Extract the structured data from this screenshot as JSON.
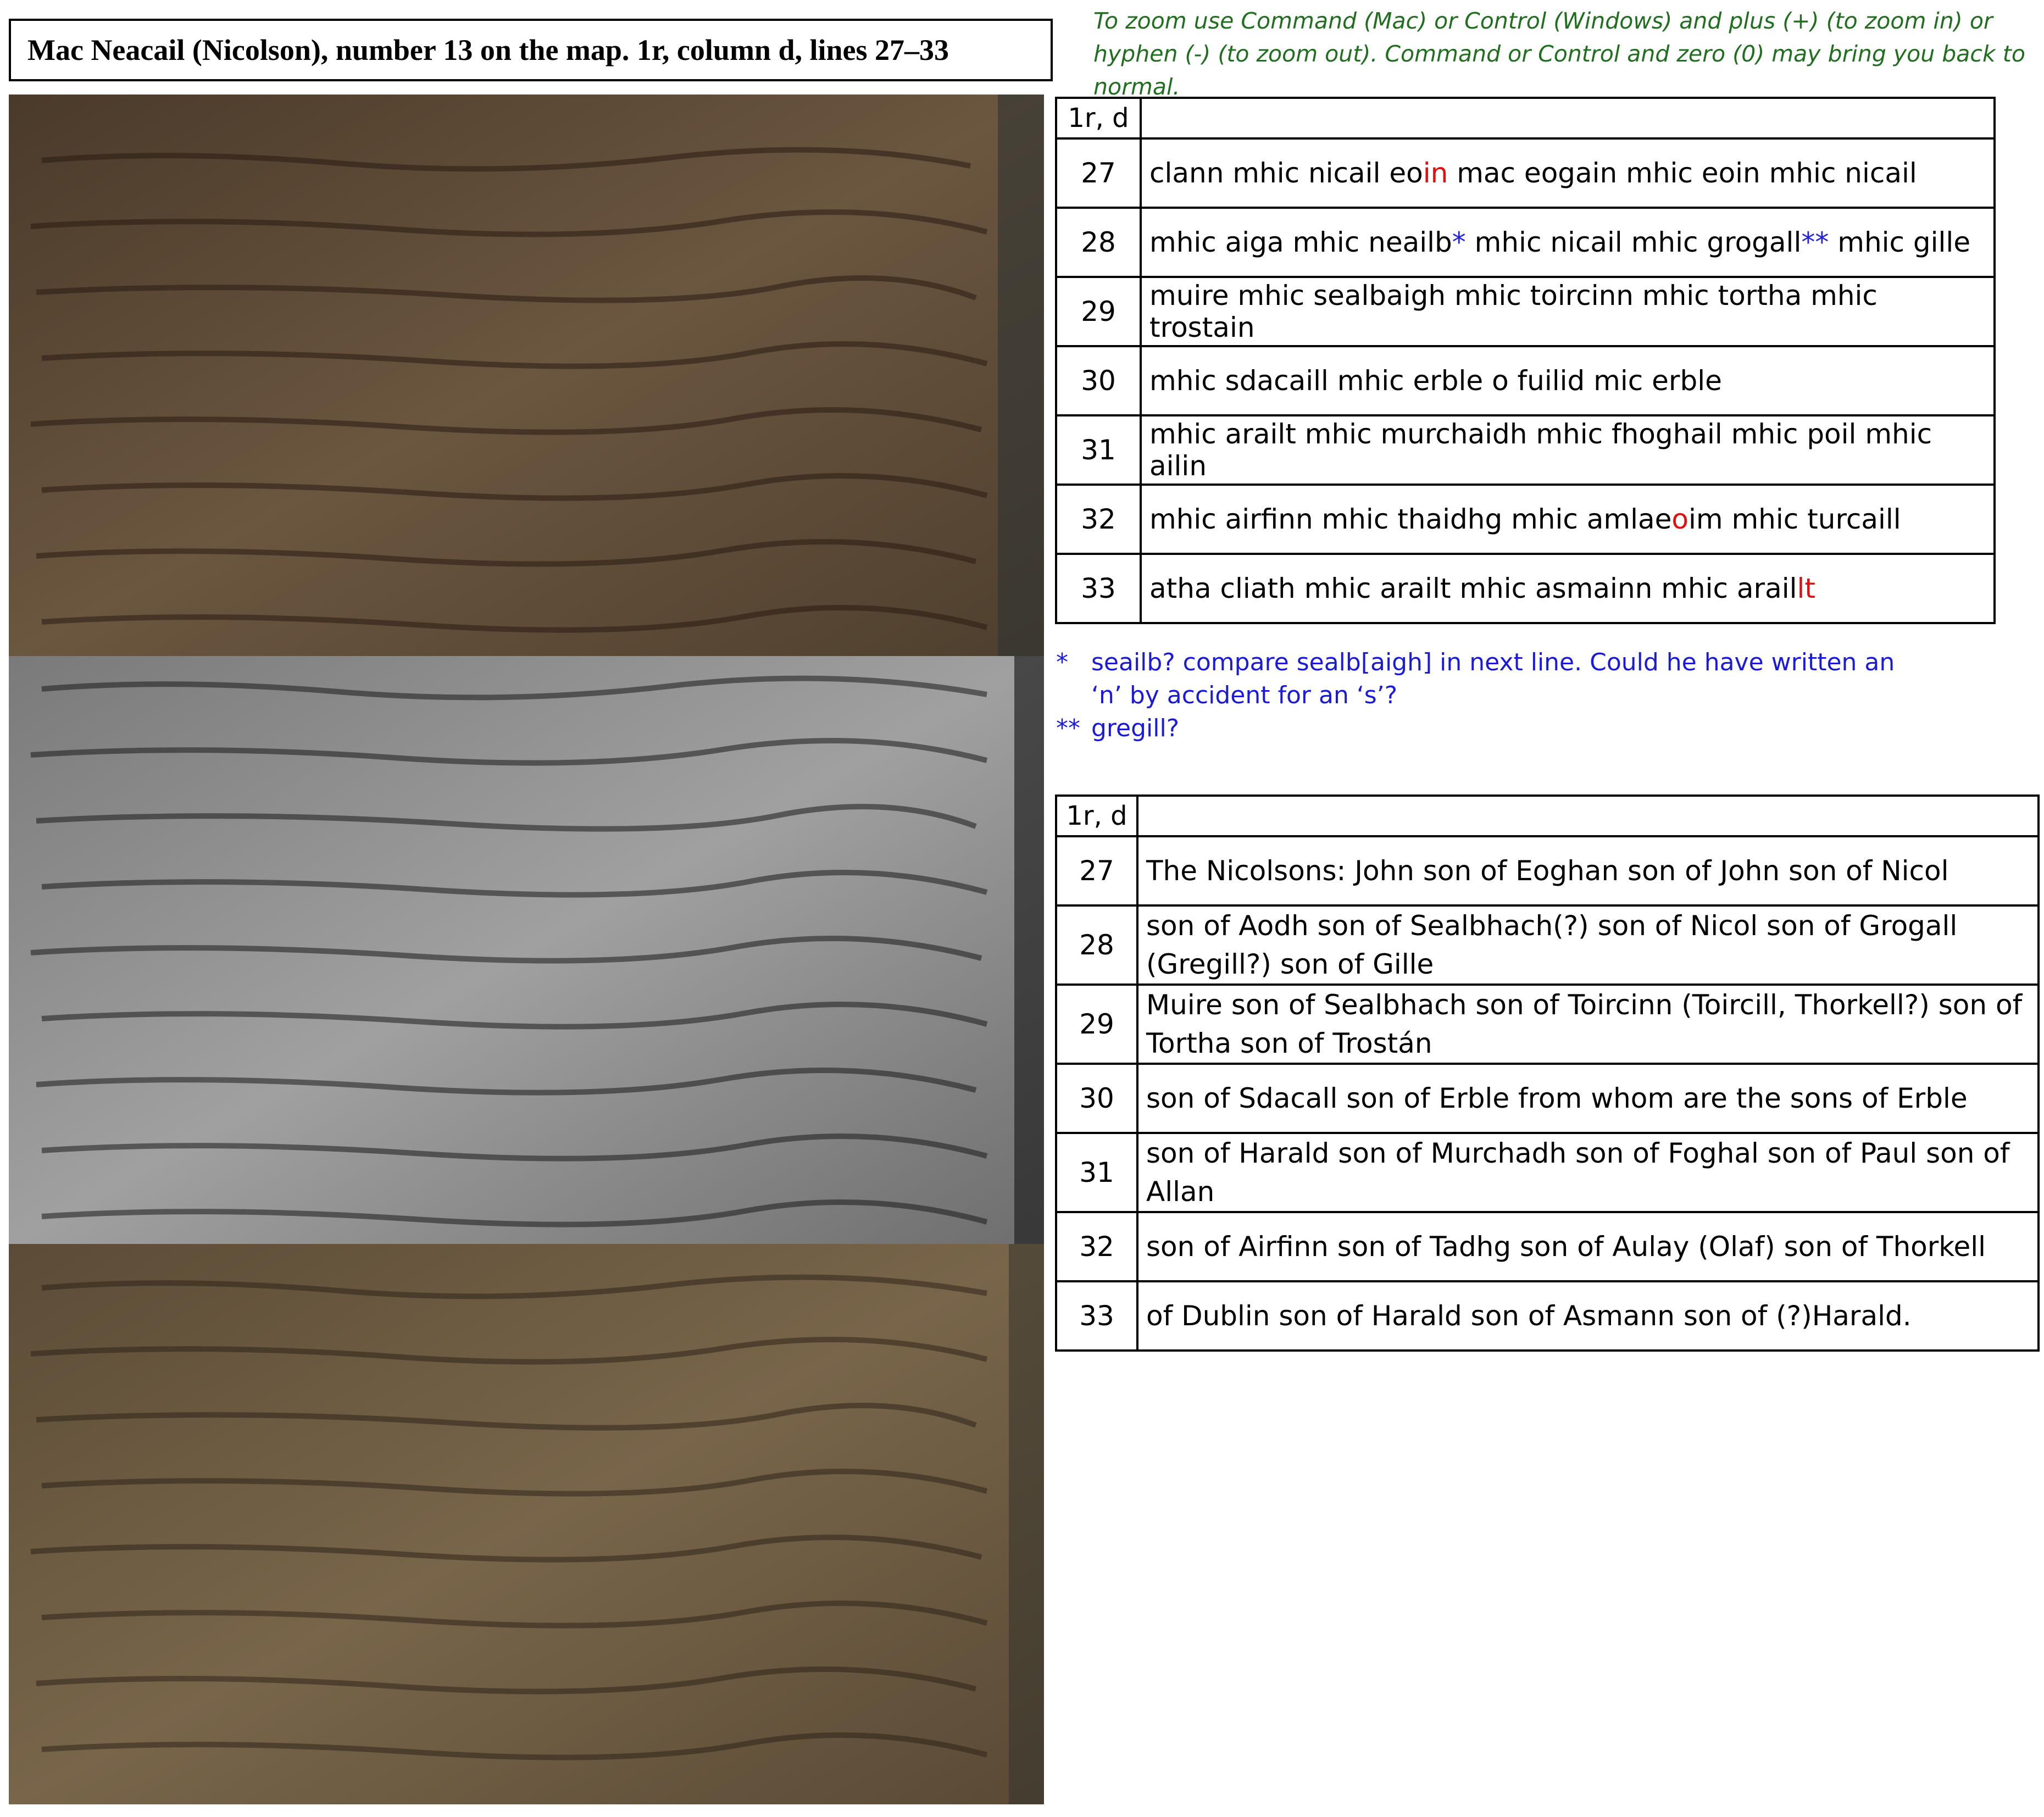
{
  "title": "Mac Neacail (Nicolson), number 13 on the map. 1r, column d, lines 27–33",
  "zoom_note": "To zoom use Command (Mac) or Control (Windows) and plus (+) (to zoom in) or hyphen (-) (to zoom out).  Command or Control and zero (0) may bring you back to normal.",
  "colors": {
    "note_green": "#1f6f1f",
    "emendation_red": "#e01010",
    "footnote_blue": "#2020e0",
    "scan_sepia_1": "#5a4632",
    "scan_gray": "#8a8a8a",
    "scan_sepia_2": "#6e5c44"
  },
  "transcription_table": {
    "header": "1r, d",
    "rows": [
      {
        "line": "27",
        "parts": [
          "clann mhic nicail eo",
          "in",
          " mac eogain mhic eoin mhic nicail"
        ]
      },
      {
        "line": "28",
        "parts": [
          "mhic aiga mhic neailb",
          "*",
          " mhic nicail mhic grogall",
          "**",
          " mhic gille"
        ]
      },
      {
        "line": "29",
        "parts": [
          "muire mhic sealbaigh mhic toircinn mhic tortha mhic trostain"
        ]
      },
      {
        "line": "30",
        "parts": [
          "mhic sdacaill mhic erble o fuilid mic erble"
        ]
      },
      {
        "line": "31",
        "parts": [
          "mhic arailt mhic murchaidh mhic fhoghail mhic poil mhic ailin"
        ]
      },
      {
        "line": "32",
        "parts": [
          "mhic airfinn mhic thaidhg mhic amlae",
          "o",
          "im mhic turcaill"
        ]
      },
      {
        "line": "33",
        "parts": [
          "atha cliath mhic arailt mhic asmainn mhic arail",
          "lt"
        ]
      }
    ]
  },
  "footnotes": [
    {
      "mark": "*",
      "text": "seailb? compare sealb[aigh] in next line. Could he have written an ‘n’ by accident for an ‘s’?"
    },
    {
      "mark": "**",
      "text": "gregill?"
    }
  ],
  "translation_table": {
    "header": "1r, d",
    "rows": [
      {
        "line": "27",
        "text": "The Nicolsons: John son of Eoghan son of John son of Nicol"
      },
      {
        "line": "28",
        "text": "son of Aodh son of Sealbhach(?) son of Nicol son of Grogall (Gregill?) son of Gille"
      },
      {
        "line": "29",
        "text": "Muire son of Sealbhach son of Toircinn (Toircill, Thorkell?) son of Tortha son of Trostán"
      },
      {
        "line": "30",
        "text": "son of Sdacall son of Erble from whom are the sons of Erble"
      },
      {
        "line": "31",
        "text": "son of Harald son of Murchadh son of Foghal son of Paul son of Allan"
      },
      {
        "line": "32",
        "text": "son of Airfinn son of Tadhg son of Aulay (Olaf) son of Thorkell"
      },
      {
        "line": "33",
        "text": "of Dublin son of Harald son of Asmann son of (?)Harald."
      }
    ]
  }
}
